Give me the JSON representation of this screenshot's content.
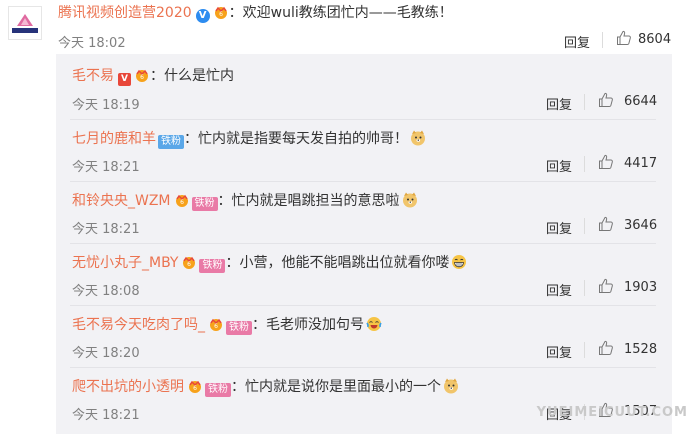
{
  "main_comment": {
    "username": "腾讯视频创造营2020",
    "text": "：欢迎wuli教练团忙内——毛教练！",
    "time": "今天 18:02",
    "reply_label": "回复",
    "likes": "8604"
  },
  "replies": [
    {
      "username": "毛不易",
      "text": "：什么是忙内",
      "time": "今天 18:19",
      "reply_label": "回复",
      "likes": "6644"
    },
    {
      "username": "七月的鹿和羊",
      "fan_badge": "铁粉",
      "text": "：忙内就是指要每天发自拍的帅哥！",
      "time": "今天 18:21",
      "reply_label": "回复",
      "likes": "4417"
    },
    {
      "username": "和铃央央_WZM",
      "fan_badge": "铁粉",
      "text": "：忙内就是唱跳担当的意思啦",
      "time": "今天 18:21",
      "reply_label": "回复",
      "likes": "3646"
    },
    {
      "username": "无忧小丸子_MBY",
      "fan_badge": "铁粉",
      "text": "：小营，他能不能唱跳出位就看你喽",
      "time": "今天 18:08",
      "reply_label": "回复",
      "likes": "1903"
    },
    {
      "username": "毛不易今天吃肉了吗_",
      "fan_badge": "铁粉",
      "text": "：毛老师没加句号",
      "time": "今天 18:20",
      "reply_label": "回复",
      "likes": "1528"
    },
    {
      "username": "爬不出坑的小透明",
      "fan_badge": "铁粉",
      "text": "：忙内就是说你是里面最小的一个",
      "time": "今天 18:21",
      "reply_label": "回复",
      "likes": "1507"
    }
  ],
  "watermark": "YUEIMEICUUT.COM",
  "colors": {
    "username": "#eb7350",
    "reply_bg": "#f2f2f5",
    "meta": "#808080"
  }
}
